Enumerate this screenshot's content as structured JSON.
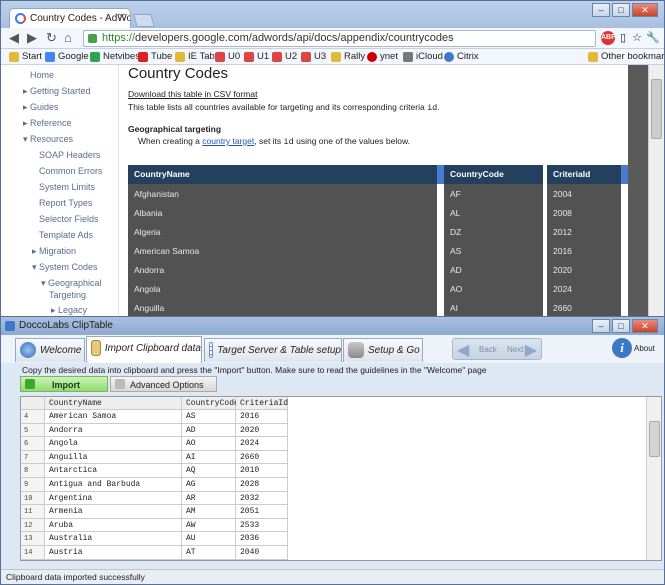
{
  "browser": {
    "tab_title": "Country Codes - AdWords",
    "url_scheme": "https://",
    "url_rest": "developers.google.com/adwords/api/docs/appendix/countrycodes",
    "bookmarks": [
      "Start",
      "Google",
      "Netvibes",
      "Tube",
      "IE Tab",
      "U0",
      "U1",
      "U2",
      "U3",
      "Rally",
      "ynet",
      "iCloud",
      "Citrix"
    ],
    "other_bookmarks": "Other bookmarks"
  },
  "sidenav": {
    "items": [
      "Home",
      "Getting Started",
      "Guides",
      "Reference",
      "Resources",
      "SOAP Headers",
      "Common Errors",
      "System Limits",
      "Report Types",
      "Selector Fields",
      "Template Ads",
      "Migration",
      "System Codes",
      "Geographical",
      "Targeting",
      "Legacy"
    ]
  },
  "page": {
    "title": "Country Codes",
    "csv_link": "Download this table in CSV format",
    "desc_pre": "This table lists all countries available for targeting and its corresponding criteria ",
    "desc_code": "id",
    "desc_post": ".",
    "section_title": "Geographical targeting",
    "section_pre": "When creating a ",
    "section_link": "country target",
    "section_mid": ", set its ",
    "section_code": "id",
    "section_post": " using one of the values below.",
    "table_headers": [
      "CountryName",
      "CountryCode",
      "CriteriaId"
    ],
    "table_rows": [
      [
        "Afghanistan",
        "AF",
        "2004"
      ],
      [
        "Albania",
        "AL",
        "2008"
      ],
      [
        "Algeria",
        "DZ",
        "2012"
      ],
      [
        "American Samoa",
        "AS",
        "2016"
      ],
      [
        "Andorra",
        "AD",
        "2020"
      ],
      [
        "Angola",
        "AO",
        "2024"
      ],
      [
        "Anguilla",
        "AI",
        "2660"
      ]
    ]
  },
  "cliptable": {
    "title": "DoccoLabs ClipTable",
    "tabs": [
      "Welcome",
      "Import Clipboard data",
      "Target Server & Table setup",
      "Setup & Go"
    ],
    "back_label": "Back",
    "next_label": "Next",
    "about_label": "About",
    "instruction": "Copy the desired data into clipboard and press the \"Import\" button. Make sure to read the guidelines in the \"Welcome\" page",
    "import_label": "Import",
    "advanced_label": "Advanced Options",
    "grid_headers": [
      "CountryName",
      "CountryCode",
      "CriteriaId"
    ],
    "grid_rows": [
      [
        "4",
        "American Samoa",
        "AS",
        "2016"
      ],
      [
        "5",
        "Andorra",
        "AD",
        "2020"
      ],
      [
        "6",
        "Angola",
        "AO",
        "2024"
      ],
      [
        "7",
        "Anguilla",
        "AI",
        "2660"
      ],
      [
        "8",
        "Antarctica",
        "AQ",
        "2010"
      ],
      [
        "9",
        "Antigua and Barbuda",
        "AG",
        "2028"
      ],
      [
        "10",
        "Argentina",
        "AR",
        "2032"
      ],
      [
        "11",
        "Armenia",
        "AM",
        "2051"
      ],
      [
        "12",
        "Aruba",
        "AW",
        "2533"
      ],
      [
        "13",
        "Australia",
        "AU",
        "2036"
      ],
      [
        "14",
        "Austria",
        "AT",
        "2040"
      ]
    ],
    "status": "Clipboard data imported successfully"
  }
}
